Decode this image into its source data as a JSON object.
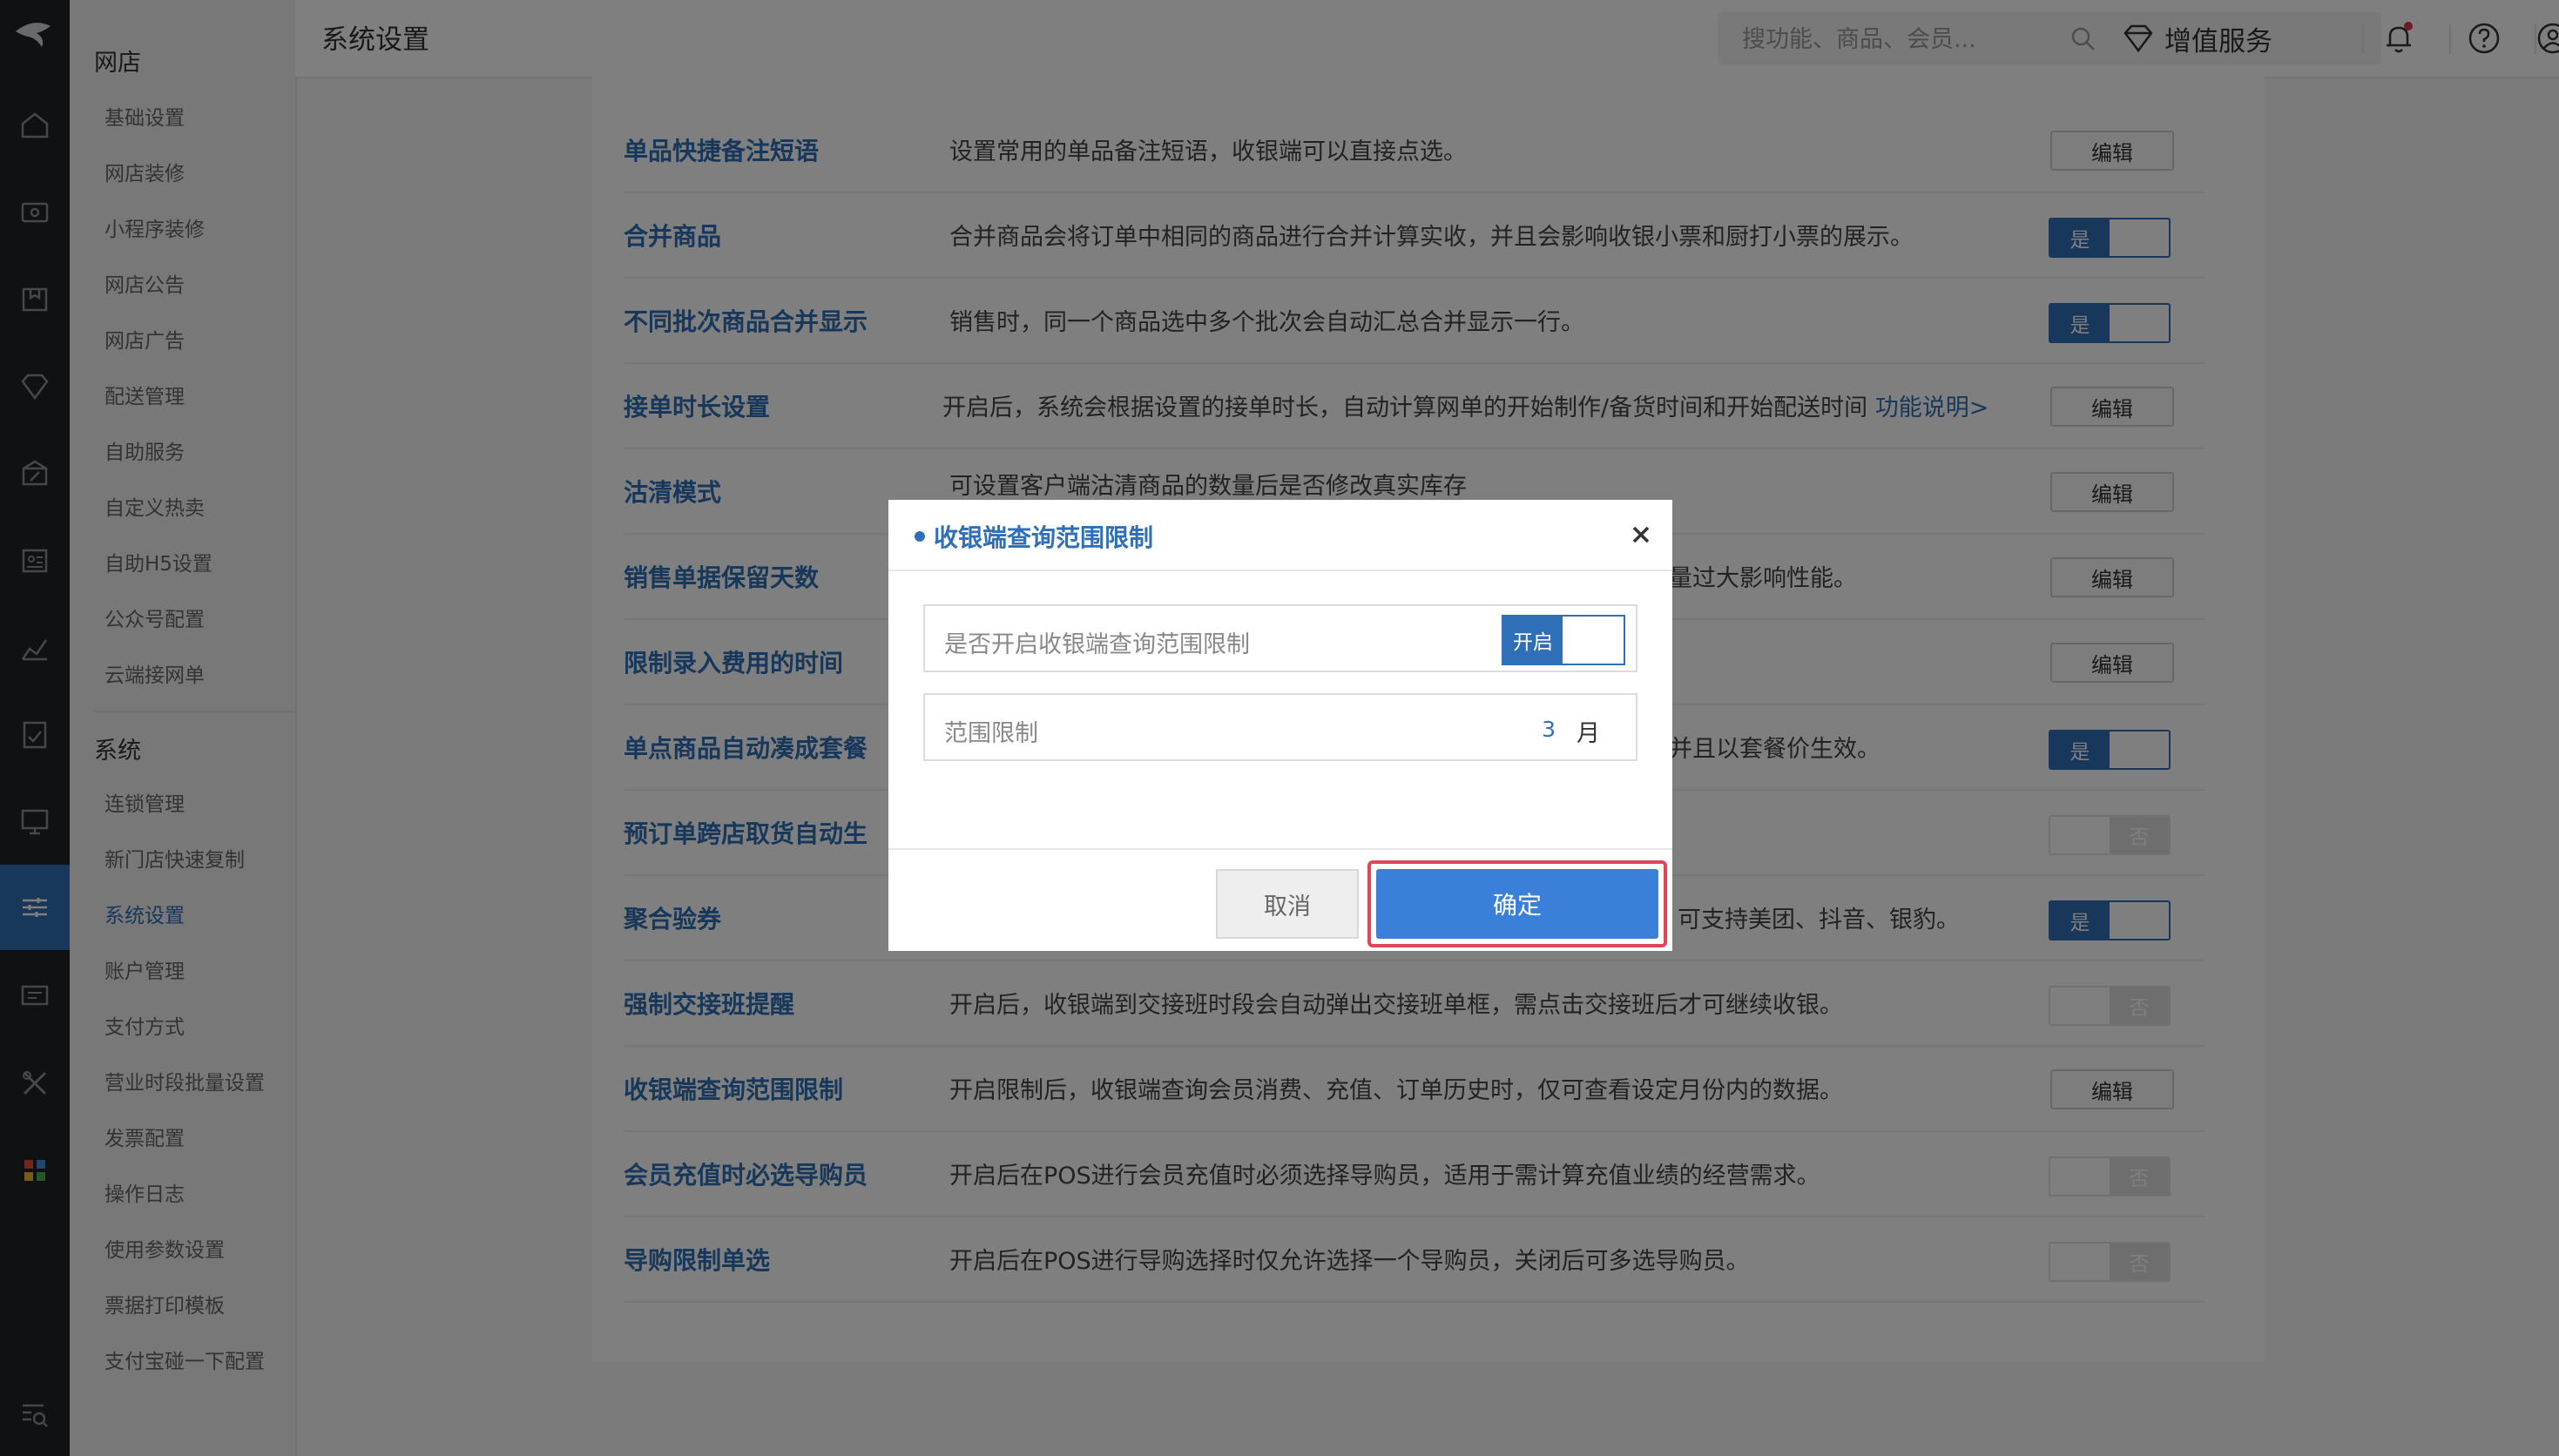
{
  "header": {
    "title": "系统设置",
    "search_placeholder": "搜功能、商品、会员...",
    "value_service": "增值服务"
  },
  "sidebar": {
    "groups": [
      {
        "title": "网店",
        "items": [
          "基础设置",
          "网店装修",
          "小程序装修",
          "网店公告",
          "网店广告",
          "配送管理",
          "自助服务",
          "自定义热卖",
          "自助H5设置",
          "公众号配置",
          "云端接网单"
        ]
      },
      {
        "title": "系统",
        "items": [
          "连锁管理",
          "新门店快速复制",
          "系统设置",
          "账户管理",
          "支付方式",
          "营业时段批量设置",
          "发票配置",
          "操作日志",
          "使用参数设置",
          "票据打印模板",
          "支付宝碰一下配置"
        ]
      }
    ],
    "active_item": "系统设置"
  },
  "settings": {
    "edit_label": "编辑",
    "yes_label": "是",
    "no_label": "否",
    "rows": [
      {
        "name": "单品快捷备注短语",
        "desc": "设置常用的单品备注短语，收银端可以直接点选。",
        "control": "edit"
      },
      {
        "name": "合并商品",
        "desc": "合并商品会将订单中相同的商品进行合并计算实收，并且会影响收银小票和厨打小票的展示。",
        "control": "on"
      },
      {
        "name": "不同批次商品合并显示",
        "desc": "销售时，同一个商品选中多个批次会自动汇总合并显示一行。",
        "control": "on"
      },
      {
        "name": "接单时长设置",
        "desc": "开启后，系统会根据设置的接单时长，自动计算网单的开始制作/备货时间和开始配送时间",
        "link": "功能说明>",
        "control": "edit"
      },
      {
        "name": "沽清模式",
        "desc": "可设置客户端沽清商品的数量后是否修改真实库存",
        "control": "edit"
      },
      {
        "name": "销售单据保留天数",
        "desc": "量过大影响性能。",
        "control": "edit"
      },
      {
        "name": "限制录入费用的时间",
        "desc": "",
        "control": "edit"
      },
      {
        "name": "单点商品自动凑成套餐",
        "desc": "并且以套餐价生效。",
        "control": "on"
      },
      {
        "name": "预订单跨店取货自动生",
        "desc": "",
        "control": "off"
      },
      {
        "name": "聚合验券",
        "desc": "可支持美团、抖音、银豹。",
        "control": "on"
      },
      {
        "name": "强制交接班提醒",
        "desc": "开启后，收银端到交接班时段会自动弹出交接班单框，需点击交接班后才可继续收银。",
        "control": "off"
      },
      {
        "name": "收银端查询范围限制",
        "desc": "开启限制后，收银端查询会员消费、充值、订单历史时，仅可查看设定月份内的数据。",
        "control": "edit"
      },
      {
        "name": "会员充值时必选导购员",
        "desc": "开启后在POS进行会员充值时必须选择导购员，适用于需计算充值业绩的经营需求。",
        "control": "off"
      },
      {
        "name": "导购限制单选",
        "desc": "开启后在POS进行导购选择时仅允许选择一个导购员，关闭后可多选导购员。",
        "control": "off"
      }
    ]
  },
  "modal": {
    "title": "收银端查询范围限制",
    "enable_label": "是否开启收银端查询范围限制",
    "switch_label": "开启",
    "range_label": "范围限制",
    "range_value": "3",
    "range_unit": "月",
    "cancel_label": "取消",
    "ok_label": "确定"
  },
  "colors": {
    "accent": "#2f6fb7",
    "primary_button": "#3a7fd8",
    "highlight_outline": "#e0455a",
    "rail_bg": "#1f2227"
  }
}
